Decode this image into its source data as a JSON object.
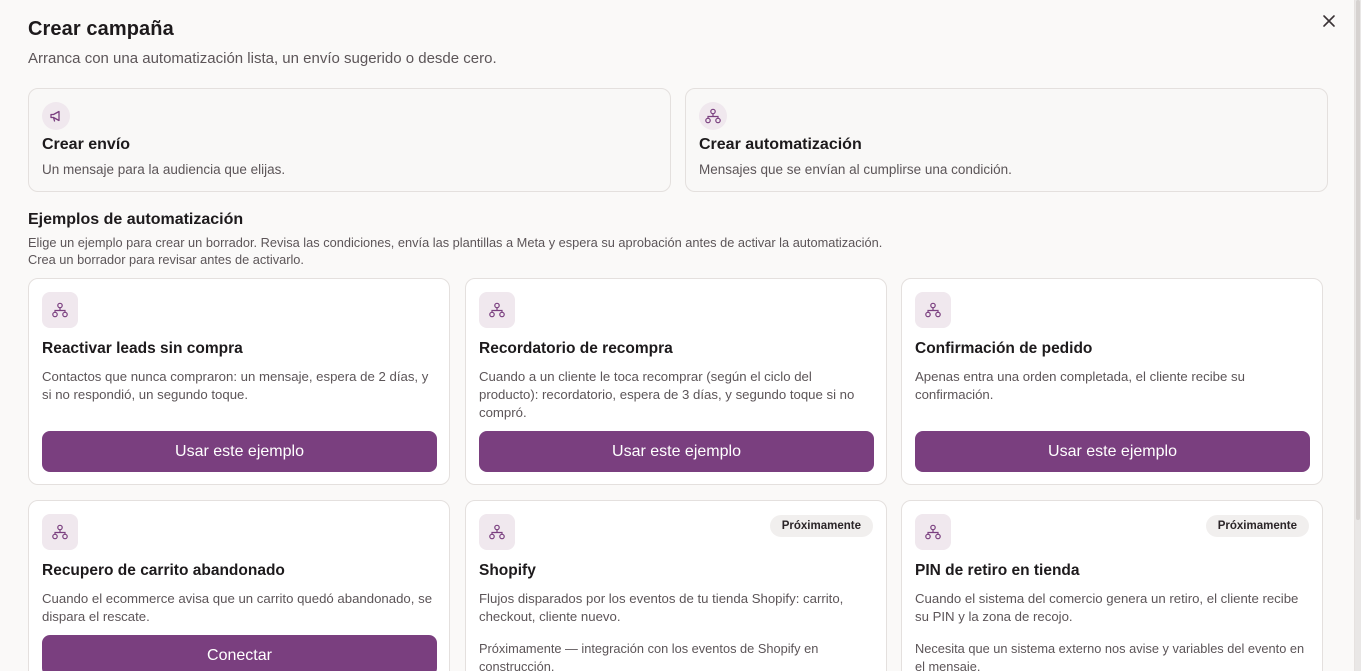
{
  "header": {
    "title": "Crear campaña",
    "subtitle": "Arranca con una automatización lista, un envío sugerido o desde cero."
  },
  "top_options": [
    {
      "title": "Crear envío",
      "desc": "Un mensaje para la audiencia que elijas.",
      "icon": "megaphone-icon"
    },
    {
      "title": "Crear automatización",
      "desc": "Mensajes que se envían al cumplirse una condición.",
      "icon": "workflow-icon"
    }
  ],
  "examples_section": {
    "title": "Ejemplos de automatización",
    "desc_line1": "Elige un ejemplo para crear un borrador. Revisa las condiciones, envía las plantillas a Meta y espera su aprobación antes de activar la automatización.",
    "desc_line2": "Crea un borrador para revisar antes de activarlo."
  },
  "examples": [
    {
      "title": "Reactivar leads sin compra",
      "desc": "Contactos que nunca compraron: un mensaje, espera de 2 días, y si no respondió, un segundo toque.",
      "button": "Usar este ejemplo"
    },
    {
      "title": "Recordatorio de recompra",
      "desc": "Cuando a un cliente le toca recomprar (según el ciclo del producto): recordatorio, espera de 3 días, y segundo toque si no compró.",
      "button": "Usar este ejemplo"
    },
    {
      "title": "Confirmación de pedido",
      "desc": "Apenas entra una orden completada, el cliente recibe su confirmación.",
      "button": "Usar este ejemplo"
    },
    {
      "title": "Recupero de carrito abandonado",
      "desc": "Cuando el ecommerce avisa que un carrito quedó abandonado, se dispara el rescate.",
      "button": "Conectar"
    },
    {
      "title": "Shopify",
      "desc": "Flujos disparados por los eventos de tu tienda Shopify: carrito, checkout, cliente nuevo.",
      "badge": "Próximamente",
      "note": "Próximamente — integración con los eventos de Shopify en construcción."
    },
    {
      "title": "PIN de retiro en tienda",
      "desc": "Cuando el sistema del comercio genera un retiro, el cliente recibe su PIN y la zona de recojo.",
      "badge": "Próximamente",
      "note": "Necesita que un sistema externo nos avise y variables del evento en el mensaje."
    }
  ],
  "colors": {
    "primary": "#7a3f7f",
    "icon_bg": "#f0e8ee"
  }
}
